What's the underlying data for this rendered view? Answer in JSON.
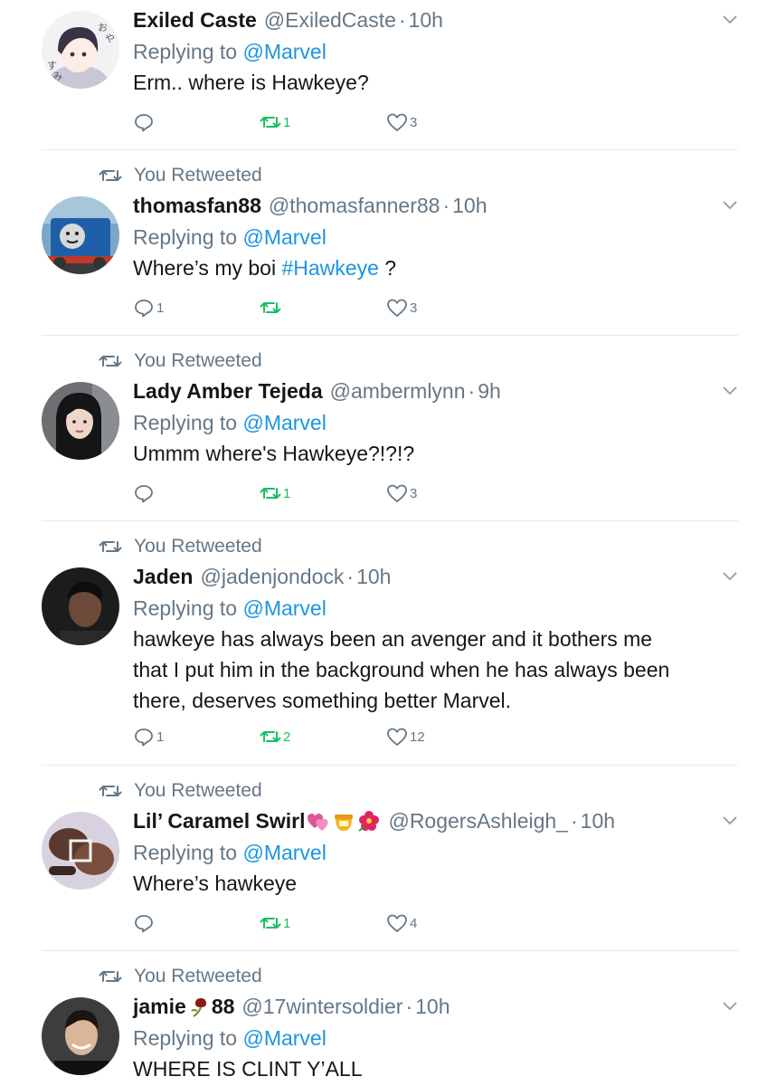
{
  "retweet_context_label": "You Retweeted",
  "reply_prefix": "Replying to",
  "colors": {
    "link": "#1b95e0",
    "retweet_green": "#17bf63",
    "secondary": "#657786",
    "divider": "#e1e8ed"
  },
  "tweets": [
    {
      "name": "Exiled Caste",
      "handle": "@ExiledCaste",
      "dot": "·",
      "time": "10h",
      "replying_to": "@Marvel",
      "text": "Erm.. where is Hawkeye?",
      "reply_count": "",
      "retweet_count": "1",
      "like_count": "3"
    },
    {
      "name": "thomasfan88",
      "handle": "@thomasfanner88",
      "dot": "·",
      "time": "10h",
      "replying_to": "@Marvel",
      "text_before": "Where’s my boi",
      "hashtag": "#Hawkeye",
      "text_after": " ?",
      "reply_count": "1",
      "retweet_count": "",
      "like_count": "3"
    },
    {
      "name": "Lady Amber Tejeda",
      "handle": "@ambermlynn",
      "dot": "·",
      "time": "9h",
      "replying_to": "@Marvel",
      "text": "Ummm where's Hawkeye?!?!?",
      "reply_count": "",
      "retweet_count": "1",
      "like_count": "3"
    },
    {
      "name": "Jaden",
      "handle": "@jadenjondock",
      "dot": "·",
      "time": "10h",
      "replying_to": "@Marvel",
      "text_lines": [
        "hawkeye has always been an avenger and it bothers me",
        "that I put him in the background when he has always been",
        "there, deserves something better Marvel."
      ],
      "reply_count": "1",
      "retweet_count": "2",
      "like_count": "12"
    },
    {
      "name": "Lil’ Caramel Swirl",
      "name_emojis": [
        "heart-icon",
        "honey-pot-icon",
        "hibiscus-icon"
      ],
      "handle": "@RogersAshleigh_",
      "dot": "·",
      "time": "10h",
      "replying_to": "@Marvel",
      "text": "Where’s hawkeye",
      "reply_count": "",
      "retweet_count": "1",
      "like_count": "4"
    },
    {
      "name": "jamie",
      "name_emojis": [
        "wilted-rose-icon"
      ],
      "name_suffix": " 88",
      "handle": "@17wintersoldier",
      "dot": "·",
      "time": "10h",
      "replying_to": "@Marvel",
      "text": "WHERE IS CLINT Y’ALL"
    }
  ]
}
